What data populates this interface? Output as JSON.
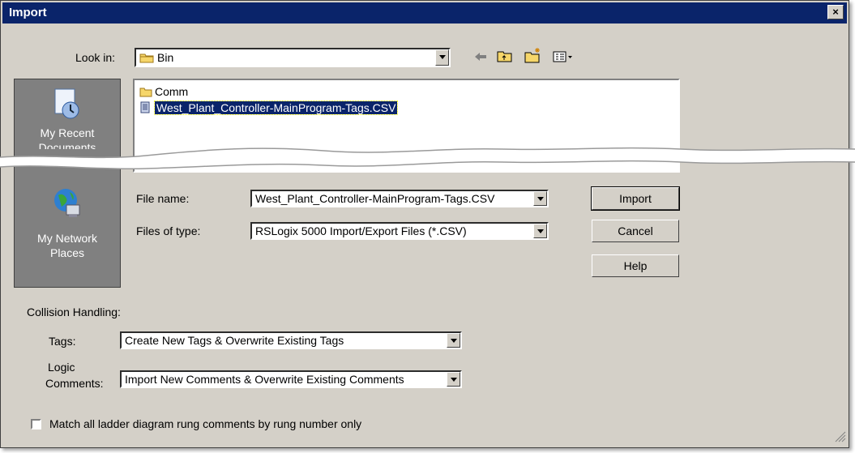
{
  "window": {
    "title": "Import",
    "close_label": "×"
  },
  "lookin": {
    "label": "Look in:",
    "value": "Bin"
  },
  "places": [
    {
      "label": "My Recent",
      "label2": "Documents"
    },
    {
      "label": "My Network",
      "label2": "Places"
    }
  ],
  "files": [
    {
      "name": "Comm",
      "type": "folder"
    },
    {
      "name": "West_Plant_Controller-MainProgram-Tags.CSV",
      "type": "file",
      "selected": true
    }
  ],
  "filename": {
    "label": "File name:",
    "value": "West_Plant_Controller-MainProgram-Tags.CSV"
  },
  "filetype": {
    "label": "Files of type:",
    "value": "RSLogix 5000 Import/Export Files (*.CSV)"
  },
  "buttons": {
    "import": "Import",
    "cancel": "Cancel",
    "help": "Help"
  },
  "collision": {
    "heading": "Collision Handling:",
    "tags_label": "Tags:",
    "tags_value": "Create New Tags & Overwrite Existing Tags",
    "comments_label_1": "Logic",
    "comments_label_2": "Comments:",
    "comments_value": "Import New Comments & Overwrite Existing Comments"
  },
  "checkbox": {
    "label": "Match all ladder diagram rung comments by rung number only",
    "checked": false
  }
}
